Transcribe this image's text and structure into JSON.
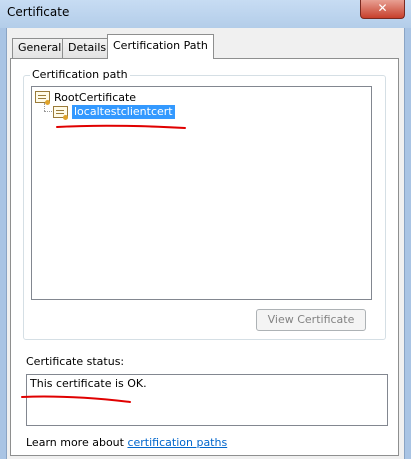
{
  "window": {
    "title": "Certificate",
    "close_glyph": "✕"
  },
  "tabs": [
    {
      "label": "General",
      "active": false
    },
    {
      "label": "Details",
      "active": false
    },
    {
      "label": "Certification Path",
      "active": true
    }
  ],
  "certification_path": {
    "group_label": "Certification path",
    "tree": [
      {
        "label": "RootCertificate",
        "icon": "certificate-icon",
        "selected": false,
        "level": 0
      },
      {
        "label": "localtestclientcert",
        "icon": "certificate-icon",
        "selected": true,
        "level": 1
      }
    ],
    "view_button_label": "View Certificate",
    "view_button_enabled": false
  },
  "status": {
    "label": "Certificate status:",
    "text": "This certificate is OK."
  },
  "footer": {
    "prefix": "Learn more about ",
    "link_text": "certification paths"
  },
  "colors": {
    "selection": "#3399ff",
    "link": "#0066cc",
    "annotation": "#e00000"
  }
}
